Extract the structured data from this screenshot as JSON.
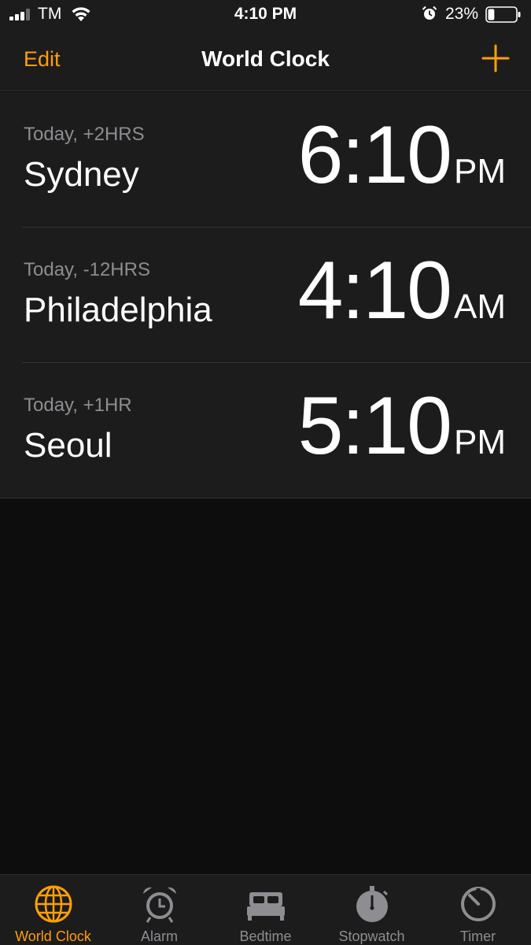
{
  "status_bar": {
    "carrier": "TM",
    "time": "4:10 PM",
    "battery_percent": "23%",
    "battery_level": 0.23,
    "icons": [
      "signal-icon",
      "wifi-icon",
      "alarm-icon",
      "battery-icon"
    ]
  },
  "nav": {
    "edit_label": "Edit",
    "title": "World Clock",
    "add_icon": "plus-icon"
  },
  "clocks": [
    {
      "offset": "Today, +2HRS",
      "city": "Sydney",
      "time": "6:10",
      "ampm": "PM"
    },
    {
      "offset": "Today, -12HRS",
      "city": "Philadelphia",
      "time": "4:10",
      "ampm": "AM"
    },
    {
      "offset": "Today, +1HR",
      "city": "Seoul",
      "time": "5:10",
      "ampm": "PM"
    }
  ],
  "tabs": [
    {
      "label": "World Clock",
      "icon": "globe-icon",
      "active": true
    },
    {
      "label": "Alarm",
      "icon": "alarm-clock-icon",
      "active": false
    },
    {
      "label": "Bedtime",
      "icon": "bed-icon",
      "active": false
    },
    {
      "label": "Stopwatch",
      "icon": "stopwatch-icon",
      "active": false
    },
    {
      "label": "Timer",
      "icon": "timer-icon",
      "active": false
    }
  ],
  "colors": {
    "accent": "#ff9f0a",
    "background": "#0d0d0d",
    "surface": "#1c1c1c",
    "secondary_text": "#8d8d92"
  }
}
